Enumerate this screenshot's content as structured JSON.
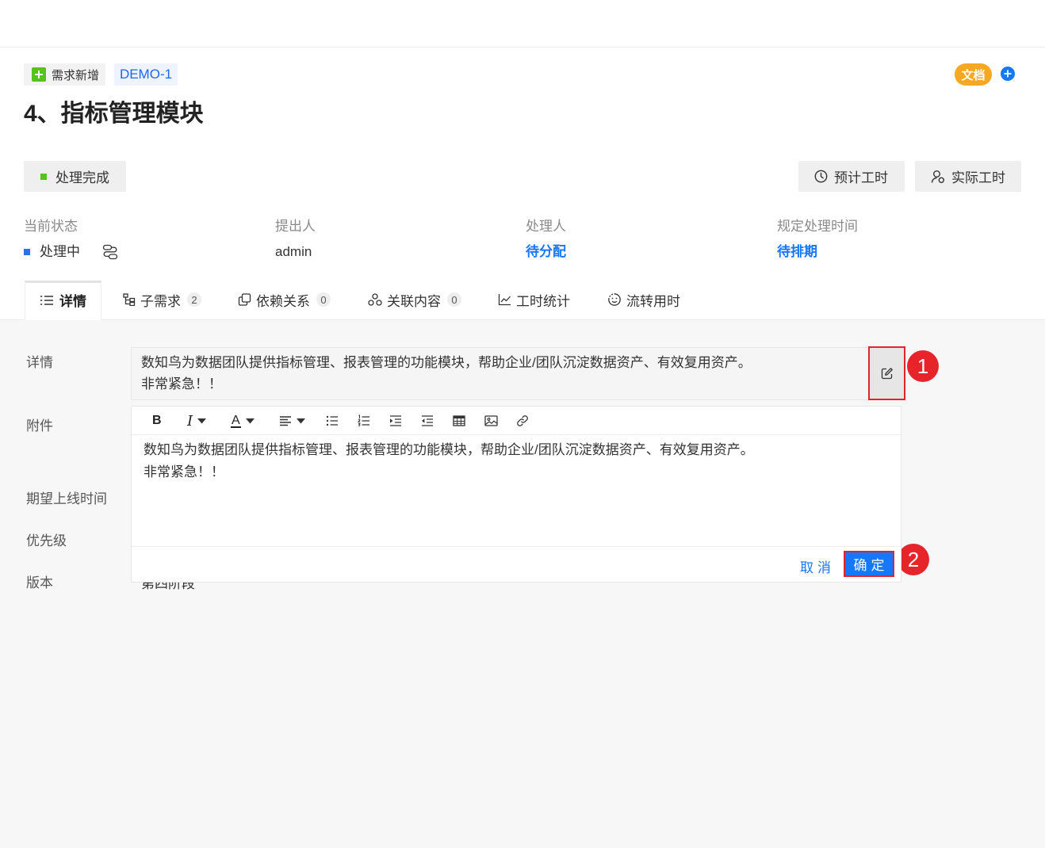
{
  "header": {
    "type_tag": {
      "label": "需求新增",
      "icon": "plus-square-icon"
    },
    "id_tag": "DEMO-1",
    "doc_badge": "文档",
    "add_button_icon": "plus-circle-icon",
    "title": "4、指标管理模块"
  },
  "status_button": {
    "label": "处理完成",
    "indicator_color": "#52c41a"
  },
  "work_hours": {
    "estimated": {
      "label": "预计工时",
      "icon": "clock-icon"
    },
    "actual": {
      "label": "实际工时",
      "icon": "user-icon"
    }
  },
  "fields": {
    "current_status": {
      "label": "当前状态",
      "value": "处理中",
      "indicator_color": "#2f6df6",
      "icon": "flow-icon"
    },
    "proposer": {
      "label": "提出人",
      "value": "admin"
    },
    "assignee": {
      "label": "处理人",
      "value": "待分配"
    },
    "deadline": {
      "label": "规定处理时间",
      "value": "待排期"
    }
  },
  "tabs": [
    {
      "label": "详情",
      "icon": "list-icon",
      "active": true
    },
    {
      "label": "子需求",
      "count": "2",
      "icon": "subtask-icon"
    },
    {
      "label": "依赖关系",
      "count": "0",
      "icon": "copy-icon"
    },
    {
      "label": "关联内容",
      "count": "0",
      "icon": "cluster-icon"
    },
    {
      "label": "工时统计",
      "icon": "line-chart-icon"
    },
    {
      "label": "流转用时",
      "icon": "timer-icon"
    }
  ],
  "form": {
    "detail": {
      "label": "详情",
      "lines": [
        "数知鸟为数据团队提供指标管理、报表管理的功能模块，帮助企业/团队沉淀数据资产、有效复用资产。",
        "非常紧急！！"
      ],
      "edit_icon": "edit-icon"
    },
    "attachment": {
      "label": "附件"
    },
    "expected_launch": {
      "label": "期望上线时间"
    },
    "priority": {
      "label": "优先级"
    },
    "version": {
      "label": "版本",
      "value": "第四阶段"
    }
  },
  "editor": {
    "toolbar": {
      "bold_label": "B",
      "italic_label": "I",
      "font_color_label": "A",
      "icons": [
        "bold-icon",
        "italic-icon",
        "font-color-icon",
        "align-icon",
        "bullet-list-icon",
        "ordered-list-icon",
        "indent-icon",
        "outdent-icon",
        "table-icon",
        "image-icon",
        "link-icon"
      ]
    },
    "lines": [
      "数知鸟为数据团队提供指标管理、报表管理的功能模块，帮助企业/团队沉淀数据资产、有效复用资产。",
      "非常紧急！！"
    ],
    "cancel_label": "取消",
    "confirm_label": "确定"
  },
  "callouts": {
    "step_1": "1",
    "step_2": "2"
  },
  "colors": {
    "accent_blue": "#1677ff",
    "highlight_red": "#e3242b",
    "doc_orange": "#f7a823",
    "success_green": "#52c41a",
    "content_background": "#f7f7f7"
  }
}
